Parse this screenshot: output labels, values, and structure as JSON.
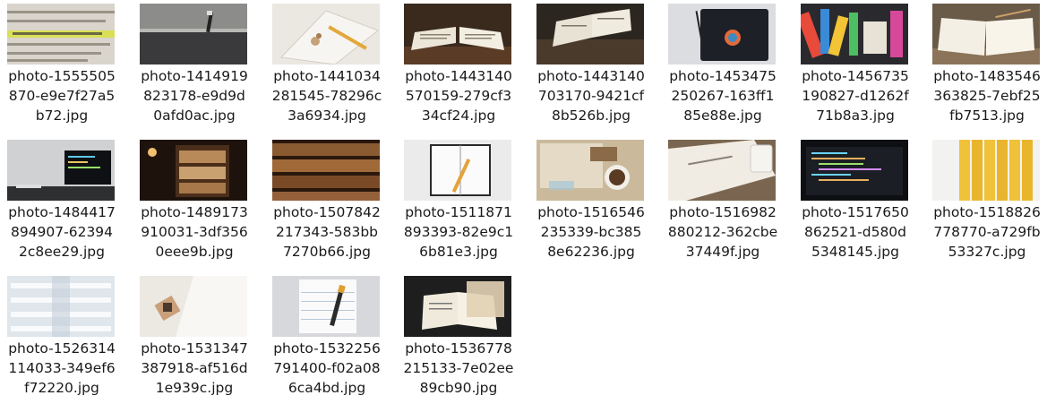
{
  "files": [
    {
      "name": "photo-1555505870-e9e7f27a5b72.jpg",
      "lines": [
        "photo-1555505",
        "870-e9e7f27a5",
        "b72.jpg"
      ],
      "thumbnail": "highlighted-text"
    },
    {
      "name": "photo-1414919823178-e9d9d0afd0ac.jpg",
      "lines": [
        "photo-1414919",
        "823178-e9d9d",
        "0afd0ac.jpg"
      ],
      "thumbnail": "book-pen"
    },
    {
      "name": "photo-1441034281545-78296c3a6934.jpg",
      "lines": [
        "photo-1441034",
        "281545-78296c",
        "3a6934.jpg"
      ],
      "thumbnail": "notebook-pencil"
    },
    {
      "name": "photo-1443140570159-279cf334cf24.jpg",
      "lines": [
        "photo-1443140",
        "570159-279cf3",
        "34cf24.jpg"
      ],
      "thumbnail": "open-book-dark"
    },
    {
      "name": "photo-1443140703170-9421cf8b526b.jpg",
      "lines": [
        "photo-1443140",
        "703170-9421cf",
        "8b526b.jpg"
      ],
      "thumbnail": "open-book-desk"
    },
    {
      "name": "photo-1453475250267-163ff185e88e.jpg",
      "lines": [
        "photo-1453475",
        "250267-163ff1",
        "85e88e.jpg"
      ],
      "thumbnail": "black-notebook"
    },
    {
      "name": "photo-1456735190827-d1262f71b8a3.jpg",
      "lines": [
        "photo-1456735",
        "190827-d1262f",
        "71b8a3.jpg"
      ],
      "thumbnail": "colorful-supplies"
    },
    {
      "name": "photo-1483546363825-7ebf25fb7513.jpg",
      "lines": [
        "photo-1483546",
        "363825-7ebf25",
        "fb7513.jpg"
      ],
      "thumbnail": "blank-book"
    },
    {
      "name": "photo-1484417894907-623942c8ee29.jpg",
      "lines": [
        "photo-1484417",
        "894907-62394",
        "2c8ee29.jpg"
      ],
      "thumbnail": "laptop-code"
    },
    {
      "name": "photo-1489173910031-3df3560eee9b.jpg",
      "lines": [
        "photo-1489173",
        "910031-3df356",
        "0eee9b.jpg"
      ],
      "thumbnail": "library-shelf"
    },
    {
      "name": "photo-1507842217343-583bb7270b66.jpg",
      "lines": [
        "photo-1507842",
        "217343-583bb",
        "7270b66.jpg"
      ],
      "thumbnail": "bookshelves"
    },
    {
      "name": "photo-1511871893393-82e9c16b81e3.jpg",
      "lines": [
        "photo-1511871",
        "893393-82e9c1",
        "6b81e3.jpg"
      ],
      "thumbnail": "planner-pencil"
    },
    {
      "name": "photo-1516546235339-bc3858e62236.jpg",
      "lines": [
        "photo-1516546",
        "235339-bc385",
        "8e62236.jpg"
      ],
      "thumbnail": "map-coffee"
    },
    {
      "name": "photo-1516982880212-362cbe37449f.jpg",
      "lines": [
        "photo-1516982",
        "880212-362cbe",
        "37449f.jpg"
      ],
      "thumbnail": "journal-mug"
    },
    {
      "name": "photo-1517650862521-d580d5348145.jpg",
      "lines": [
        "photo-1517650",
        "862521-d580d",
        "5348145.jpg"
      ],
      "thumbnail": "code-screen"
    },
    {
      "name": "photo-1518826778770-a729fb53327c.jpg",
      "lines": [
        "photo-1518826",
        "778770-a729fb",
        "53327c.jpg"
      ],
      "thumbnail": "yellow-pencils"
    },
    {
      "name": "photo-1526314114033-349ef6f72220.jpg",
      "lines": [
        "photo-1526314",
        "114033-349ef6",
        "f72220.jpg"
      ],
      "thumbnail": "white-library"
    },
    {
      "name": "photo-1531347387918-af516d1e939c.jpg",
      "lines": [
        "photo-1531347",
        "387918-af516d",
        "1e939c.jpg"
      ],
      "thumbnail": "book-corner"
    },
    {
      "name": "photo-1532256791400-f02a086ca4bd.jpg",
      "lines": [
        "photo-1532256",
        "791400-f02a08",
        "6ca4bd.jpg"
      ],
      "thumbnail": "notepad-pen"
    },
    {
      "name": "photo-1536778215133-7e02ee89cb90.jpg",
      "lines": [
        "photo-1536778",
        "215133-7e02ee",
        "89cb90.jpg"
      ],
      "thumbnail": "open-book-dark-table"
    }
  ]
}
